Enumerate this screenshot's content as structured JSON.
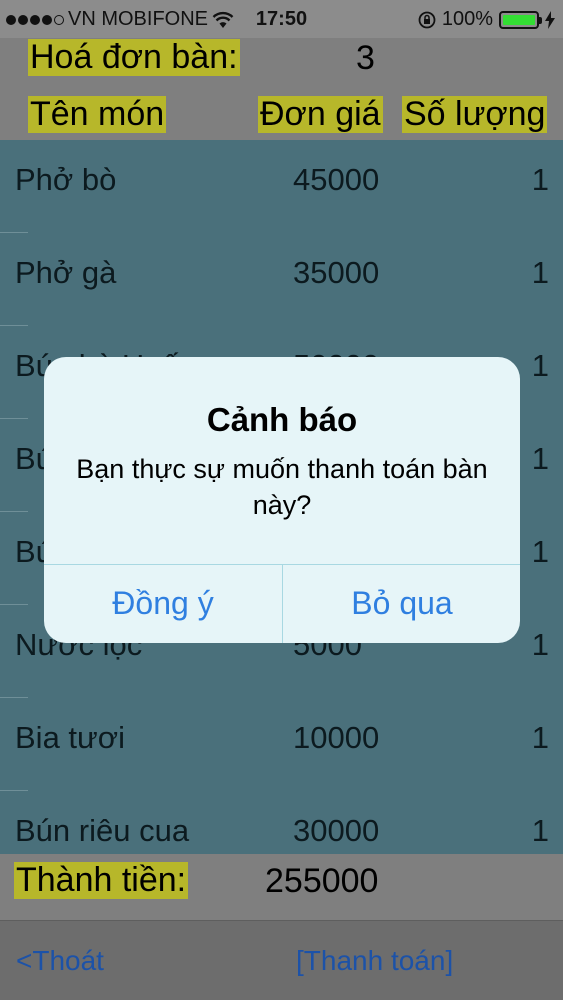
{
  "status_bar": {
    "carrier": "VN MOBIFONE",
    "time": "17:50",
    "battery_percent": "100%",
    "battery_level": 1.0,
    "signal_dots_filled": 4,
    "signal_dots_total": 5,
    "icons": [
      "wifi-icon",
      "orientation-lock-icon",
      "battery-icon",
      "charging-icon"
    ]
  },
  "header": {
    "invoice_label": "Hoá đơn bàn:",
    "table_number": "3",
    "col_name": "Tên món",
    "col_price": "Đơn giá",
    "col_qty": "Số lượng"
  },
  "items": [
    {
      "name": "Phở bò",
      "price": "45000",
      "qty": "1"
    },
    {
      "name": "Phở gà",
      "price": "35000",
      "qty": "1"
    },
    {
      "name": "Bún bò Huế",
      "price": "50000",
      "qty": "1"
    },
    {
      "name": "Bún",
      "price": "",
      "qty": "1"
    },
    {
      "name": "Bún",
      "price": "",
      "qty": "1"
    },
    {
      "name": "Nước lọc",
      "price": "5000",
      "qty": "1"
    },
    {
      "name": "Bia tươi",
      "price": "10000",
      "qty": "1"
    },
    {
      "name": "Bún riêu cua",
      "price": "30000",
      "qty": "1"
    }
  ],
  "total": {
    "label": "Thành tiền:",
    "value": "255000"
  },
  "toolbar": {
    "exit_label": "<Thoát",
    "pay_label": "[Thanh toán]"
  },
  "alert": {
    "title": "Cảnh báo",
    "message": "Bạn thực sự muốn thanh toán bàn này?",
    "ok_label": "Đồng ý",
    "cancel_label": "Bỏ qua"
  },
  "colors": {
    "highlight": "#b7b72a",
    "list_background": "#4a707b",
    "alert_button_text": "#2f7fe0",
    "toolbar_button_text": "#1c52a8"
  }
}
